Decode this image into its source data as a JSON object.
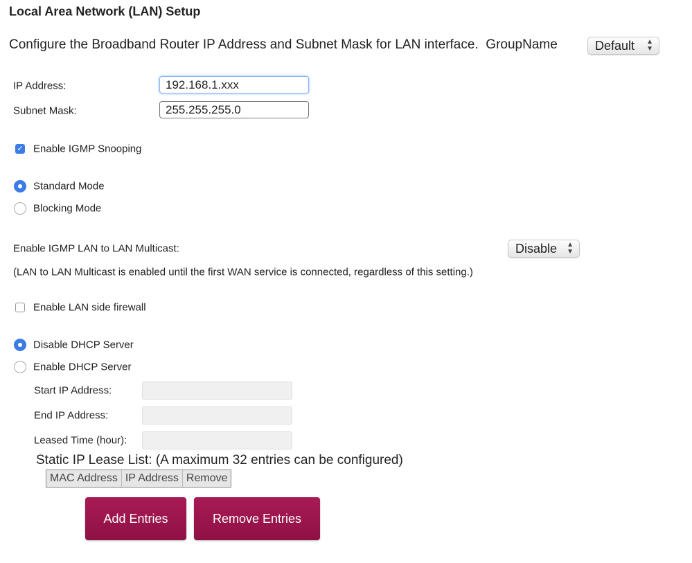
{
  "title": "Local Area Network (LAN) Setup",
  "description": "Configure the Broadband Router IP Address and Subnet Mask for LAN interface.",
  "group_name": {
    "label": "GroupName",
    "value": "Default"
  },
  "ip_address": {
    "label": "IP Address:",
    "value": "192.168.1.xxx"
  },
  "subnet_mask": {
    "label": "Subnet Mask:",
    "value": "255.255.255.0"
  },
  "igmp_snooping": {
    "label": "Enable IGMP Snooping",
    "checked": true
  },
  "modes": [
    {
      "label": "Standard Mode",
      "selected": true
    },
    {
      "label": "Blocking Mode",
      "selected": false
    }
  ],
  "multicast": {
    "label": "Enable IGMP LAN to LAN Multicast:",
    "value": "Disable",
    "note": "(LAN to LAN Multicast is enabled until the first WAN service is connected, regardless of this setting.)"
  },
  "firewall": {
    "label": "Enable LAN side firewall",
    "checked": false
  },
  "dhcp": [
    {
      "label": "Disable DHCP Server",
      "selected": true
    },
    {
      "label": "Enable DHCP Server",
      "selected": false
    }
  ],
  "dhcp_fields": [
    {
      "label": "Start IP Address:",
      "value": ""
    },
    {
      "label": "End IP Address:",
      "value": ""
    },
    {
      "label": "Leased Time (hour):",
      "value": ""
    }
  ],
  "static_lease": {
    "title": "Static IP Lease List: (A maximum 32 entries can be configured)",
    "columns": [
      "MAC Address",
      "IP Address",
      "Remove"
    ]
  },
  "buttons": {
    "add": "Add Entries",
    "remove": "Remove Entries"
  },
  "colors": {
    "accent": "#3b7ce6",
    "button": "#9a1549"
  }
}
